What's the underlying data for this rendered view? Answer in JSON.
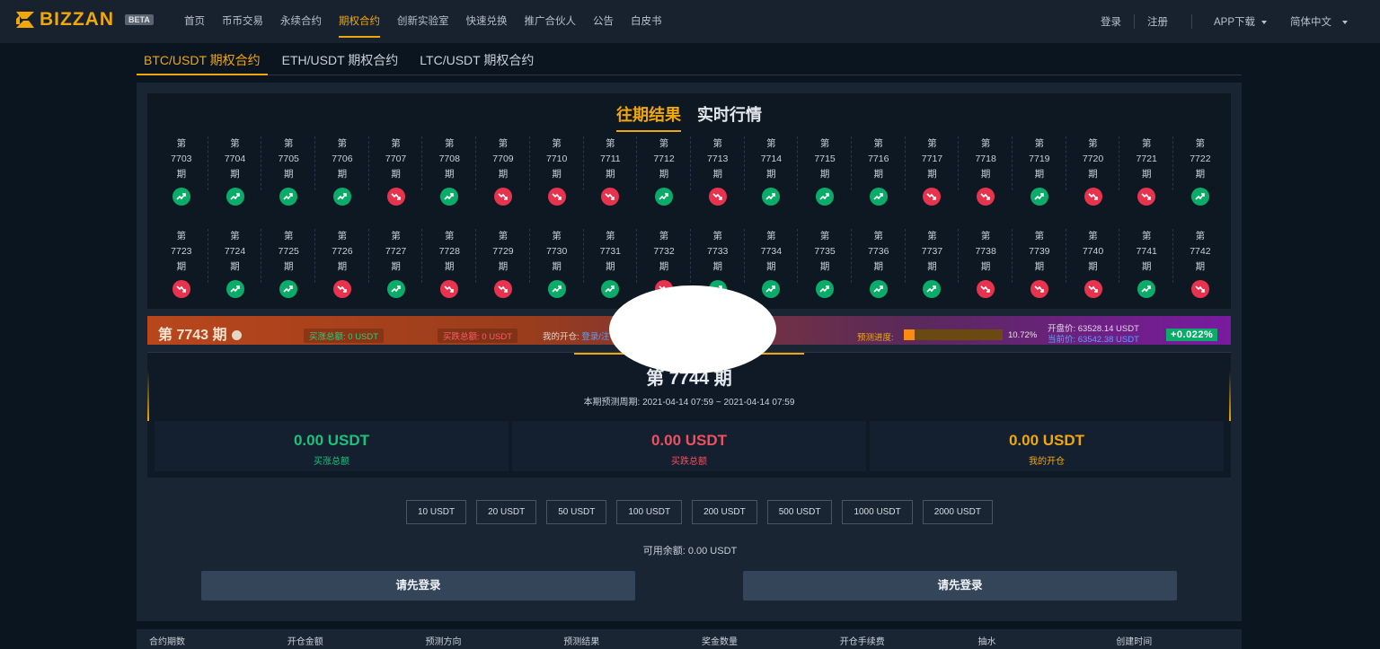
{
  "brand": {
    "name": "BIZZAN",
    "badge": "BETA"
  },
  "nav": {
    "links": [
      "首页",
      "币币交易",
      "永续合约",
      "期权合约",
      "创新实验室",
      "快速兑换",
      "推广合伙人",
      "公告",
      "白皮书"
    ],
    "active_index": 3,
    "login": "登录",
    "register": "注册",
    "app_download": "APP下载",
    "language": "简体中文"
  },
  "contract_tabs": [
    "BTC/USDT 期权合约",
    "ETH/USDT 期权合约",
    "LTC/USDT 期权合约"
  ],
  "history": {
    "tabs": [
      "往期结果",
      "实时行情"
    ],
    "active_tab": 0,
    "prefix": "第",
    "suffix": "期",
    "row1": [
      {
        "n": "7703",
        "d": "up"
      },
      {
        "n": "7704",
        "d": "up"
      },
      {
        "n": "7705",
        "d": "up"
      },
      {
        "n": "7706",
        "d": "up"
      },
      {
        "n": "7707",
        "d": "down"
      },
      {
        "n": "7708",
        "d": "up"
      },
      {
        "n": "7709",
        "d": "down"
      },
      {
        "n": "7710",
        "d": "down"
      },
      {
        "n": "7711",
        "d": "down"
      },
      {
        "n": "7712",
        "d": "up"
      },
      {
        "n": "7713",
        "d": "down"
      },
      {
        "n": "7714",
        "d": "up"
      },
      {
        "n": "7715",
        "d": "up"
      },
      {
        "n": "7716",
        "d": "up"
      },
      {
        "n": "7717",
        "d": "down"
      },
      {
        "n": "7718",
        "d": "down"
      },
      {
        "n": "7719",
        "d": "up"
      },
      {
        "n": "7720",
        "d": "down"
      },
      {
        "n": "7721",
        "d": "down"
      },
      {
        "n": "7722",
        "d": "up"
      }
    ],
    "row2": [
      {
        "n": "7723",
        "d": "down"
      },
      {
        "n": "7724",
        "d": "up"
      },
      {
        "n": "7725",
        "d": "up"
      },
      {
        "n": "7726",
        "d": "down"
      },
      {
        "n": "7727",
        "d": "up"
      },
      {
        "n": "7728",
        "d": "down"
      },
      {
        "n": "7729",
        "d": "down"
      },
      {
        "n": "7730",
        "d": "up"
      },
      {
        "n": "7731",
        "d": "up"
      },
      {
        "n": "7732",
        "d": "down"
      },
      {
        "n": "7733",
        "d": "up"
      },
      {
        "n": "7734",
        "d": "up"
      },
      {
        "n": "7735",
        "d": "up"
      },
      {
        "n": "7736",
        "d": "up"
      },
      {
        "n": "7737",
        "d": "up"
      },
      {
        "n": "7738",
        "d": "down"
      },
      {
        "n": "7739",
        "d": "down"
      },
      {
        "n": "7740",
        "d": "down"
      },
      {
        "n": "7741",
        "d": "up"
      },
      {
        "n": "7742",
        "d": "down"
      }
    ]
  },
  "period_bar": {
    "title": "第 7743 期",
    "buy_up_total": "买涨总额: 0 USDT",
    "buy_down_total": "买跌总额: 0 USDT",
    "my_open_label": "我的开仓:",
    "my_open_link": "登录/注",
    "progress_label": "预测进度:",
    "progress_value": 0.1072,
    "progress_pct": "10.72%",
    "open_price": "开盘价: 63528.14 USDT",
    "current_price": "当前价: 63542.38 USDT",
    "change": "+0.022%",
    "colors": {
      "up": "#0bab6a",
      "down": "#e8334f",
      "accent": "#f0a70a"
    }
  },
  "current": {
    "title": "第 7744 期",
    "period_range": "本期预测周期: 2021-04-14 07:59 ~ 2021-04-14 07:59",
    "stats": [
      {
        "value": "0.00 USDT",
        "label": "买涨总额",
        "color": "green"
      },
      {
        "value": "0.00 USDT",
        "label": "买跌总额",
        "color": "red"
      },
      {
        "value": "0.00 USDT",
        "label": "我的开仓",
        "color": "gold"
      }
    ]
  },
  "amounts": [
    "10 USDT",
    "20 USDT",
    "50 USDT",
    "100 USDT",
    "200 USDT",
    "500 USDT",
    "1000 USDT",
    "2000 USDT"
  ],
  "balance": "可用余额: 0.00 USDT",
  "login_buttons": [
    "请先登录",
    "请先登录"
  ],
  "table_headers": [
    "合约期数",
    "开仓金额",
    "预测方向",
    "预测结果",
    "奖金数量",
    "开仓手续费",
    "抽水",
    "创建时间"
  ]
}
